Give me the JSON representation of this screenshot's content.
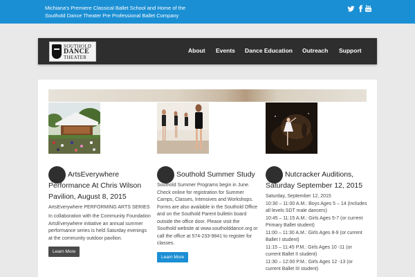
{
  "header": {
    "tagline_line1": "Michiana's Premiere Classical Ballet School and Home of the",
    "tagline_line2": "Southold Dance Theater Pre Professional Ballet Company",
    "social_icons": [
      "twitter-icon",
      "facebook-icon",
      "youtube-icon"
    ]
  },
  "logo": {
    "line1": "SOUTHOLD",
    "line2": "DANCE",
    "line3": "THEATER"
  },
  "nav": {
    "items": [
      {
        "label": "About"
      },
      {
        "label": "Events"
      },
      {
        "label": "Dance Education"
      },
      {
        "label": "Outreach"
      },
      {
        "label": "Support"
      }
    ]
  },
  "posts": [
    {
      "title": "ArtsEverywhere Performance At Chris Wilson Pavilion, August 8, 2015",
      "subtitle": "ArtsEverywhere PERFORMING ARTS SERIES",
      "body": "In collaboration with the Community Foundation ArtsEverywhere initiative an annual summer performance series is held Saturday evenings at the community outdoor pavilion.",
      "button": "Learn More"
    },
    {
      "title": "Southold Summer Study",
      "body": "Southold Summer Programs begin in June. Check online for registration for Summer Camps, Classes, Intensives and Workshops. Forms are also available in the Southold Office and on the Southold Parent bulletin board outside the office door. Please visit the Southold website at www.southolddance.org or call the office at 574-233-9841 to register for classes.",
      "button": "Learn More"
    },
    {
      "title": "Nutcracker Auditions, Saturday September 12, 2015",
      "lines": [
        "Saturday, September 12, 2015",
        "10:30 – 11:00 A.M.: Boys Ages 5 – 14 (includes all levels SDT male dancers)",
        "10:45 – 11:15 A.M.: Girls Ages 5-7 (or current Primary Ballet student)",
        "11:00 – 11:30 A.M.: Girls Ages 8-9 (or current Ballet I student)",
        "11:15 – 11:45 P.M.: Girls Ages 10 -11 (or current Ballet II student)",
        "11:30 – 12:00 P.M.: Girls Ages 12 -13 (or current Ballet III student)"
      ]
    }
  ],
  "colors": {
    "topbar": "#1b8fd4",
    "nav": "#2e2e2e",
    "button_dark": "#4a4a4a",
    "button_blue": "#1b8fd4"
  }
}
